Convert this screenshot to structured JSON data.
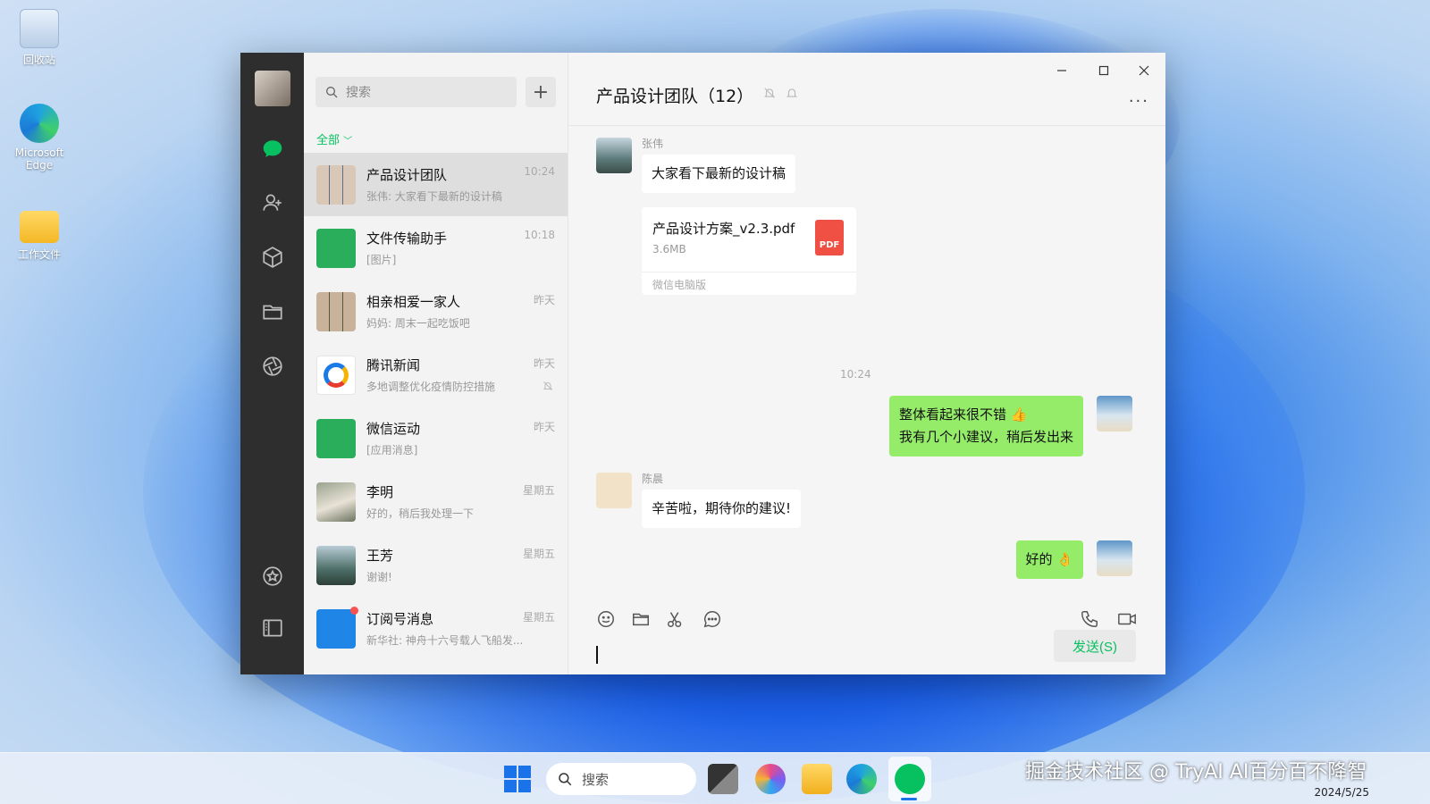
{
  "desktop": {
    "icons": [
      {
        "label": "回收站",
        "icon": "recycle-bin-icon"
      },
      {
        "label": "Microsoft Edge",
        "icon": "edge-icon"
      },
      {
        "label": "工作文件",
        "icon": "folder-icon"
      }
    ]
  },
  "sidebar": {
    "icons": [
      "chat-icon",
      "contacts-icon",
      "cube-icon",
      "folder-icon",
      "moments-icon",
      "favorites-icon",
      "settings-panel-icon"
    ]
  },
  "list": {
    "search_placeholder": "搜索",
    "add_label": "+",
    "filter_label": "全部",
    "conversations": [
      {
        "name": "产品设计团队",
        "preview": "张伟: 大家看下最新的设计稿",
        "time": "10:24",
        "avatar": "group-avatar",
        "active": true
      },
      {
        "name": "文件传输助手",
        "preview": "[图片]",
        "time": "10:18",
        "avatar": "file-transfer-avatar"
      },
      {
        "name": "相亲相爱一家人",
        "preview": "妈妈: 周末一起吃饭吧",
        "time": "昨天",
        "avatar": "family-group-avatar"
      },
      {
        "name": "腾讯新闻",
        "preview": "多地调整优化疫情防控措施",
        "time": "昨天",
        "avatar": "tencent-news-avatar",
        "muted": true
      },
      {
        "name": "微信运动",
        "preview": "[应用消息]",
        "time": "昨天",
        "avatar": "wechat-sport-avatar"
      },
      {
        "name": "李明",
        "preview": "好的，稍后我处理一下",
        "time": "星期五",
        "avatar": "dog-avatar"
      },
      {
        "name": "王芳",
        "preview": "谢谢!",
        "time": "星期五",
        "avatar": "landscape-avatar"
      },
      {
        "name": "订阅号消息",
        "preview": "新华社: 神舟十六号载人飞船发...",
        "time": "星期五",
        "avatar": "subscription-avatar",
        "unread_dot": true
      }
    ]
  },
  "chat": {
    "title": "产品设计团队（12）",
    "more_label": "···",
    "messages": {
      "m1_sender": "张伟",
      "m1_text": "大家看下最新的设计稿",
      "file_name": "产品设计方案_v2.3.pdf",
      "file_size": "3.6MB",
      "file_type": "PDF",
      "file_source": "微信电脑版",
      "timestamp": "10:24",
      "m2_line1": "整体看起来很不错 👍",
      "m2_line2": "我有几个小建议，稍后发出来",
      "m3_sender": "陈晨",
      "m3_text": "辛苦啦，期待你的建议!",
      "m4_text": "好的 👌"
    },
    "send_label": "发送(S)"
  },
  "taskbar": {
    "search_placeholder": "搜索",
    "date": "2024/5/25",
    "watermark": "掘金技术社区 @ TryAI AI百分百不降智"
  },
  "colors": {
    "accent_green": "#07c160",
    "my_bubble": "#95ec69",
    "sidebar_dark": "#2e2e2e"
  }
}
